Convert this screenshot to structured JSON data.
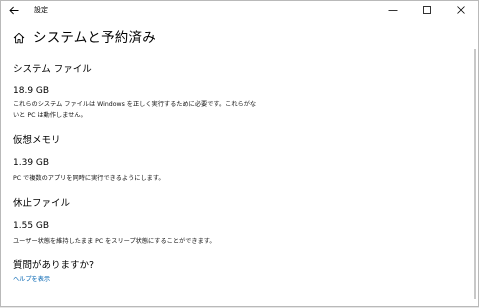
{
  "window": {
    "title": "設定"
  },
  "header": {
    "title": "システムと予約済み"
  },
  "sections": [
    {
      "heading": "システム ファイル",
      "size": "18.9 GB",
      "description_lines": [
        "これらのシステム ファイルは Windows を正しく実行するために必要です。これらがな",
        "いと PC は動作しません。"
      ]
    },
    {
      "heading": "仮想メモリ",
      "size": "1.39 GB",
      "description_lines": [
        "PC で複数のアプリを同時に実行できるようにします。"
      ]
    },
    {
      "heading": "休止ファイル",
      "size": "1.55 GB",
      "description_lines": [
        "ユーザー状態を維持したまま PC をスリープ状態にすることができます。"
      ]
    }
  ],
  "help": {
    "heading": "質問がありますか?",
    "link": "ヘルプを表示"
  },
  "icons": {
    "back": "back-arrow-icon",
    "home": "home-icon",
    "minimize": "minimize-icon",
    "maximize": "maximize-icon",
    "close": "close-icon"
  },
  "colors": {
    "link": "#0063b1",
    "window_bg": "#ffffff",
    "frame": "#b9b9b9"
  }
}
